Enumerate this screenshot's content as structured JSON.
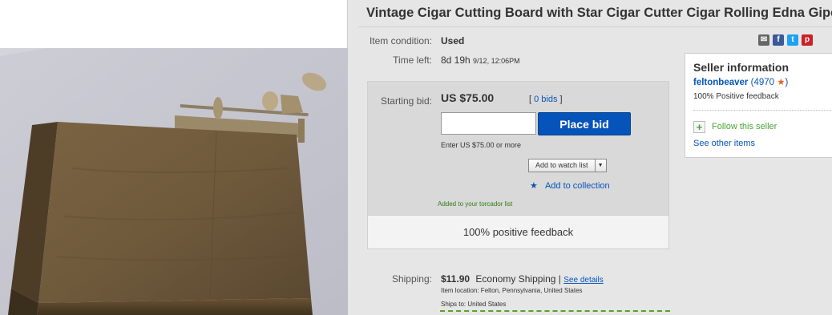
{
  "listing": {
    "title": "Vintage Cigar Cutting Board with Star Cigar Cutter Cigar Rolling Edna Gipe"
  },
  "details": {
    "condition_label": "Item condition:",
    "condition_value": "Used",
    "time_left_label": "Time left:",
    "time_left_value": "8d 19h",
    "time_left_date": "9/12, 12:06PM"
  },
  "share_icons": [
    "email-icon",
    "facebook-icon",
    "twitter-icon",
    "pinterest-icon"
  ],
  "bid": {
    "starting_label": "Starting bid:",
    "price": "US $75.00",
    "bids_open": "[",
    "bids_link": "0 bids",
    "bids_close": "]",
    "input_value": "",
    "place_bid_label": "Place bid",
    "hint": "Enter US $75.00 or more",
    "watch_label": "Add to watch list",
    "watch_dropdown": "▼",
    "collection_label": "Add to collection",
    "torcador_note": "Added to your torcador list",
    "feedback_banner": "100% positive feedback"
  },
  "seller": {
    "heading": "Seller information",
    "name": "feltonbeaver",
    "score_open": "(",
    "score": "4970",
    "score_close": ")",
    "feedback": "100% Positive feedback",
    "follow_label": "Follow this seller",
    "see_items": "See other items"
  },
  "shipping": {
    "label": "Shipping:",
    "cost": "$11.90",
    "method": "Economy Shipping",
    "separator": "|",
    "details_link": "See details",
    "location": "Item location:  Felton, Pennsylvania, United States",
    "ships_to": "Ships to:  United States"
  },
  "colors": {
    "accent": "#0654ba",
    "follow_green": "#4ca335",
    "note_green": "#2e7d10",
    "star": "#e46521"
  }
}
